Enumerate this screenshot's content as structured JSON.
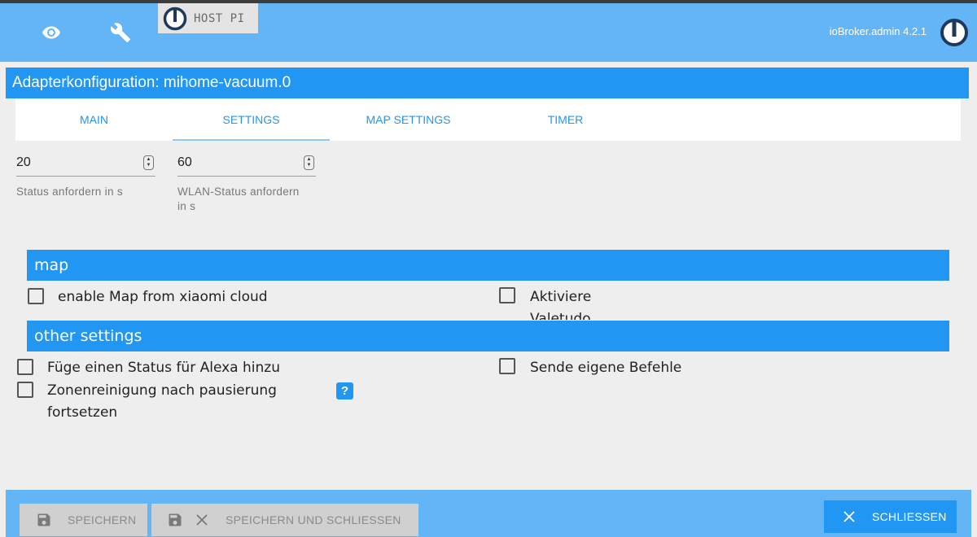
{
  "header": {
    "host_label": "HOST PI",
    "version": "ioBroker.admin 4.2.1",
    "icons": [
      "eye-icon",
      "wrench-icon",
      "iobroker-logo"
    ]
  },
  "title": "Adapterkonfiguration: mihome-vacuum.0",
  "tabs": [
    {
      "label": "MAIN",
      "active": false
    },
    {
      "label": "SETTINGS",
      "active": true
    },
    {
      "label": "MAP SETTINGS",
      "active": false
    },
    {
      "label": "TIMER",
      "active": false
    }
  ],
  "fields": [
    {
      "value": "20",
      "label": "Status anfordern in s"
    },
    {
      "value": "60",
      "label_line1": "WLAN-Status anfordern",
      "label_line2": "in s"
    }
  ],
  "sections": {
    "map": {
      "title": "map",
      "checkboxes": [
        {
          "label": "enable Map from xiaomi cloud",
          "checked": false
        },
        {
          "label": "Aktiviere",
          "label_clipped": "Valetudo",
          "checked": false
        }
      ]
    },
    "other": {
      "title": "other settings",
      "checkboxes": [
        {
          "label": "Füge einen Status für Alexa hinzu",
          "checked": false
        },
        {
          "label_line1": "Zonenreinigung nach pausierung",
          "label_line2": "fortsetzen",
          "checked": false
        },
        {
          "label": "Sende eigene Befehle",
          "checked": false
        }
      ],
      "help": "?"
    }
  },
  "footer": {
    "save": "SPEICHERN",
    "save_close": "SPEICHERN UND SCHLIESSEN",
    "close": "SCHLIESSEN"
  },
  "colors": {
    "header": "#64b5f6",
    "accent": "#2196f3",
    "background": "#eeeeee"
  }
}
